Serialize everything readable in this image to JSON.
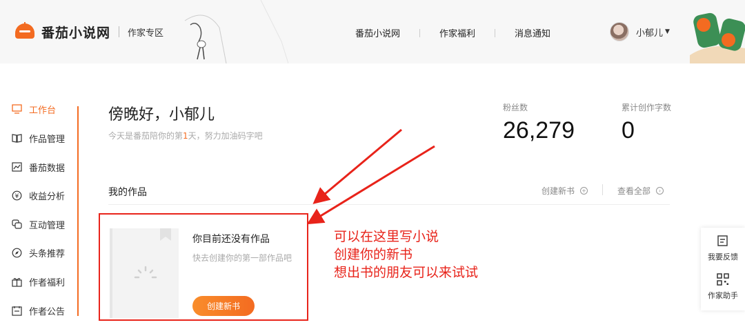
{
  "header": {
    "brand": "番茄小说网",
    "section": "作家专区",
    "nav": [
      "番茄小说网",
      "作家福利",
      "消息通知"
    ],
    "user_name": "小郁儿"
  },
  "sidebar": {
    "items": [
      {
        "label": "工作台",
        "icon": "monitor-icon",
        "active": true
      },
      {
        "label": "作品管理",
        "icon": "book-icon",
        "active": false
      },
      {
        "label": "番茄数据",
        "icon": "chart-icon",
        "active": false
      },
      {
        "label": "收益分析",
        "icon": "yen-icon",
        "active": false
      },
      {
        "label": "互动管理",
        "icon": "chat-icon",
        "active": false
      },
      {
        "label": "头条推荐",
        "icon": "compass-icon",
        "active": false
      },
      {
        "label": "作者福利",
        "icon": "gift-icon",
        "active": false
      },
      {
        "label": "作者公告",
        "icon": "announcement-icon",
        "active": false
      }
    ]
  },
  "main": {
    "greeting": "傍晚好，小郁儿",
    "sub_prefix": "今天是番茄陪你的第",
    "sub_day": "1",
    "sub_suffix": "天，努力加油码字吧",
    "stats": [
      {
        "label": "粉丝数",
        "value": "26,279"
      },
      {
        "label": "累计创作字数",
        "value": "0"
      }
    ],
    "works_title": "我的作品",
    "create_link": "创建新书",
    "view_all_link": "查看全部",
    "empty_title": "你目前还没有作品",
    "empty_sub": "快去创建你的第一部作品吧",
    "create_button": "创建新书"
  },
  "annotation": {
    "lines": [
      "可以在这里写小说",
      "创建你的新书",
      "想出书的朋友可以来试试"
    ]
  },
  "tools": [
    {
      "label": "我要反馈",
      "icon": "feedback-icon"
    },
    {
      "label": "作家助手",
      "icon": "qr-code-icon"
    }
  ],
  "colors": {
    "accent": "#f36b21",
    "annotation_red": "#e8231a"
  }
}
